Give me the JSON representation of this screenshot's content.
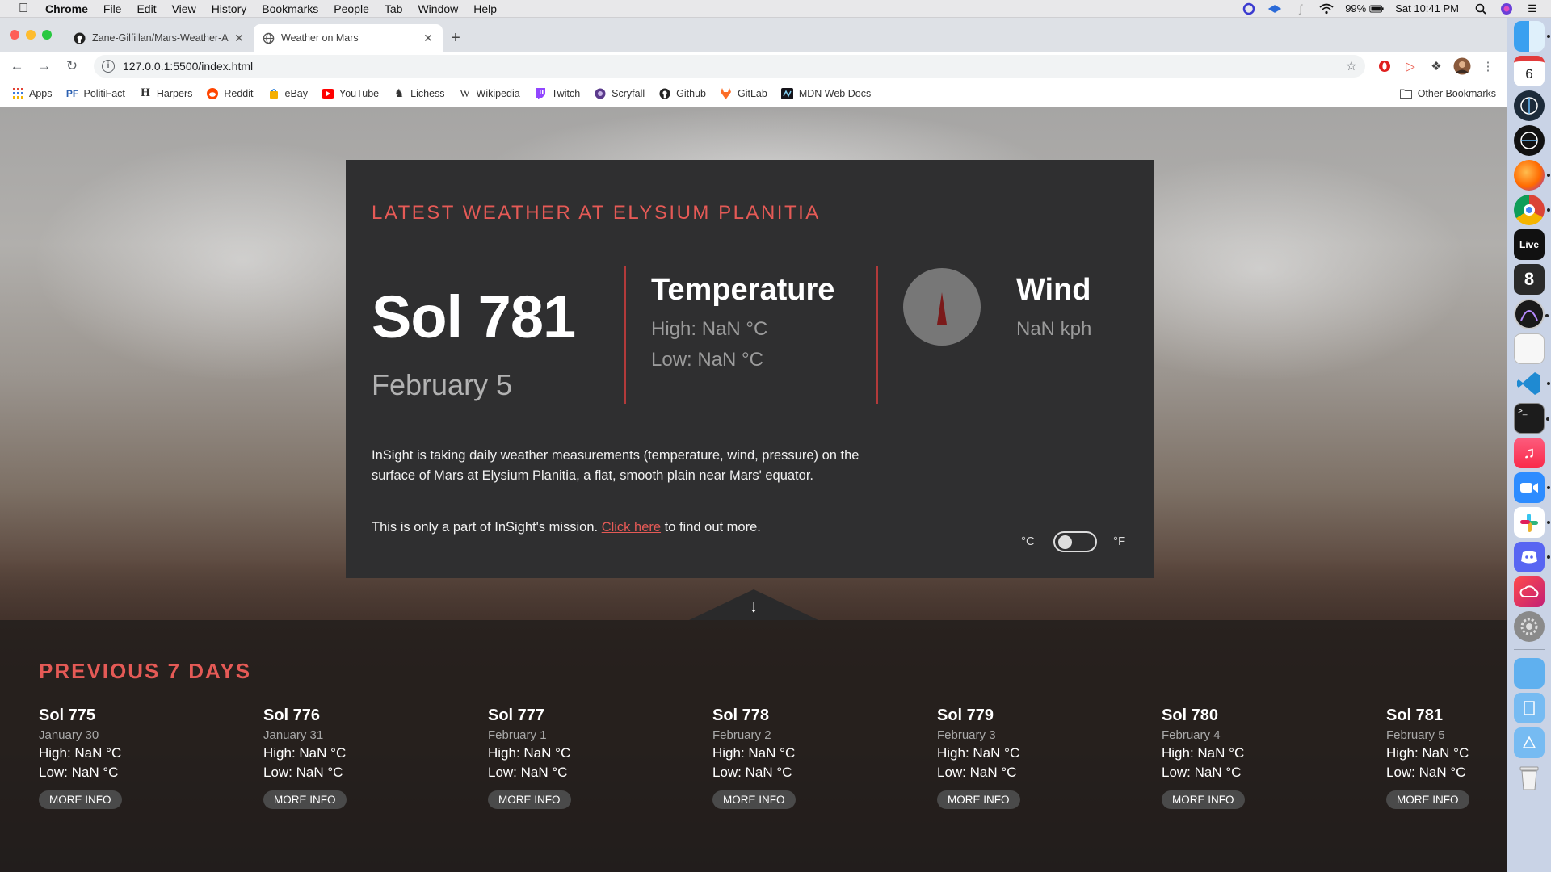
{
  "menubar": {
    "app": "Chrome",
    "items": [
      "File",
      "Edit",
      "View",
      "History",
      "Bookmarks",
      "People",
      "Tab",
      "Window",
      "Help"
    ],
    "battery": "99%",
    "clock": "Sat 10:41 PM"
  },
  "browser": {
    "tabs": [
      {
        "title": "Zane-Gilfillan/Mars-Weather-A",
        "icon": "github-icon"
      },
      {
        "title": "Weather on Mars",
        "icon": "globe-icon"
      }
    ],
    "url": "127.0.0.1:5500/index.html",
    "bookmarks": [
      {
        "label": "Apps",
        "icon": "apps-grid-icon"
      },
      {
        "label": "PolitiFact",
        "icon": "politifact-icon"
      },
      {
        "label": "Harpers",
        "icon": "harpers-icon"
      },
      {
        "label": "Reddit",
        "icon": "reddit-icon"
      },
      {
        "label": "eBay",
        "icon": "ebay-icon"
      },
      {
        "label": "YouTube",
        "icon": "youtube-icon"
      },
      {
        "label": "Lichess",
        "icon": "lichess-icon"
      },
      {
        "label": "Wikipedia",
        "icon": "wikipedia-icon"
      },
      {
        "label": "Twitch",
        "icon": "twitch-icon"
      },
      {
        "label": "Scryfall",
        "icon": "scryfall-icon"
      },
      {
        "label": "Github",
        "icon": "github-icon"
      },
      {
        "label": "GitLab",
        "icon": "gitlab-icon"
      },
      {
        "label": "MDN Web Docs",
        "icon": "mdn-icon"
      }
    ],
    "other_bookmarks": "Other Bookmarks"
  },
  "dock": {
    "calendar_day": "6",
    "live_label": "Live"
  },
  "card": {
    "title": "LATEST WEATHER AT ELYSIUM PLANITIA",
    "sol": "Sol 781",
    "date": "February 5",
    "temperature_heading": "Temperature",
    "high": "High: NaN °C",
    "low": "Low: NaN °C",
    "wind_heading": "Wind",
    "wind_speed": "NaN kph",
    "description": "InSight is taking daily weather measurements (temperature, wind, pressure) on the surface of Mars at Elysium Planitia, a flat, smooth plain near Mars' equator.",
    "mission_prefix": "This is only a part of InSight's mission. ",
    "mission_link": "Click here",
    "mission_suffix": " to find out more.",
    "unit_c": "°C",
    "unit_f": "°F",
    "unit_toggle_on": false
  },
  "previous": {
    "title": "PREVIOUS 7 DAYS",
    "days": [
      {
        "sol": "Sol 775",
        "date": "January 30",
        "high": "High: NaN °C",
        "low": "Low: NaN °C",
        "button": "MORE INFO"
      },
      {
        "sol": "Sol 776",
        "date": "January 31",
        "high": "High: NaN °C",
        "low": "Low: NaN °C",
        "button": "MORE INFO"
      },
      {
        "sol": "Sol 777",
        "date": "February 1",
        "high": "High: NaN °C",
        "low": "Low: NaN °C",
        "button": "MORE INFO"
      },
      {
        "sol": "Sol 778",
        "date": "February 2",
        "high": "High: NaN °C",
        "low": "Low: NaN °C",
        "button": "MORE INFO"
      },
      {
        "sol": "Sol 779",
        "date": "February 3",
        "high": "High: NaN °C",
        "low": "Low: NaN °C",
        "button": "MORE INFO"
      },
      {
        "sol": "Sol 780",
        "date": "February 4",
        "high": "High: NaN °C",
        "low": "Low: NaN °C",
        "button": "MORE INFO"
      },
      {
        "sol": "Sol 781",
        "date": "February 5",
        "high": "High: NaN °C",
        "low": "Low: NaN °C",
        "button": "MORE INFO"
      }
    ]
  },
  "colors": {
    "accent": "#e55a56",
    "card_bg": "#2f2f30",
    "divider": "#b23a3a"
  }
}
